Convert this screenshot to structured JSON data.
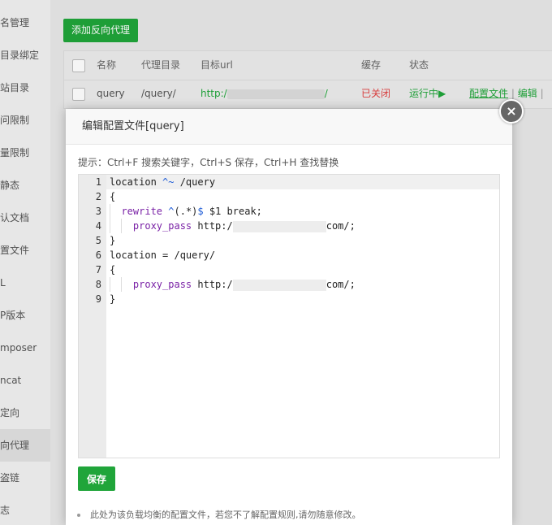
{
  "sidebar": {
    "items": [
      {
        "label": "名管理",
        "active": false
      },
      {
        "label": "目录绑定",
        "active": false
      },
      {
        "label": "站目录",
        "active": false
      },
      {
        "label": "问限制",
        "active": false
      },
      {
        "label": "量限制",
        "active": false
      },
      {
        "label": "静态",
        "active": false
      },
      {
        "label": "认文档",
        "active": false
      },
      {
        "label": "置文件",
        "active": false
      },
      {
        "label": "L",
        "active": false
      },
      {
        "label": "P版本",
        "active": false
      },
      {
        "label": "mposer",
        "active": false
      },
      {
        "label": "ncat",
        "active": false
      },
      {
        "label": "定向",
        "active": false
      },
      {
        "label": "向代理",
        "active": true
      },
      {
        "label": "盗链",
        "active": false
      },
      {
        "label": "志",
        "active": false
      }
    ]
  },
  "toolbar": {
    "add_proxy_label": "添加反向代理"
  },
  "table": {
    "headers": [
      "名称",
      "代理目录",
      "目标url",
      "缓存",
      "状态"
    ],
    "row": {
      "name": "query",
      "dir": "/query/",
      "url_prefix": "http:/",
      "url_suffix": "/",
      "cache": "已关闭",
      "status": "运行中▶",
      "action_config": "配置文件",
      "separator": "|",
      "action_edit": "编辑",
      "separator2": "|"
    }
  },
  "dialog": {
    "title": "编辑配置文件[query]",
    "hint": "提示：Ctrl+F 搜索关键字，Ctrl+S 保存，Ctrl+H 查找替换",
    "save_label": "保存",
    "note": "此处为该负载均衡的配置文件，若您不了解配置规则,请勿随意修改。",
    "close_glyph": "×"
  },
  "editor": {
    "line_numbers": [
      "1",
      "2",
      "3",
      "4",
      "5",
      "6",
      "7",
      "8",
      "9"
    ],
    "lines": {
      "l1_kw": "location",
      "l1_op": "^~",
      "l1_rest": " /query",
      "l2": "{",
      "l3_kw": "rewrite",
      "l3_op1": "^",
      "l3_mid": "(.*)",
      "l3_op2": "$",
      "l3_rest": " $1 break;",
      "l4_kw": "proxy_pass",
      "l4_pre": " http:/",
      "l4_post": "com/;",
      "l5": "}",
      "l6": "location = /query/",
      "l7": "{",
      "l8_kw": "proxy_pass",
      "l8_pre": " http:/",
      "l8_post": "com/;",
      "l9": "}"
    }
  },
  "colors": {
    "accent": "#20a53a",
    "danger": "#e04040",
    "keyword": "#7a22a6",
    "operator": "#1d5bd6"
  }
}
